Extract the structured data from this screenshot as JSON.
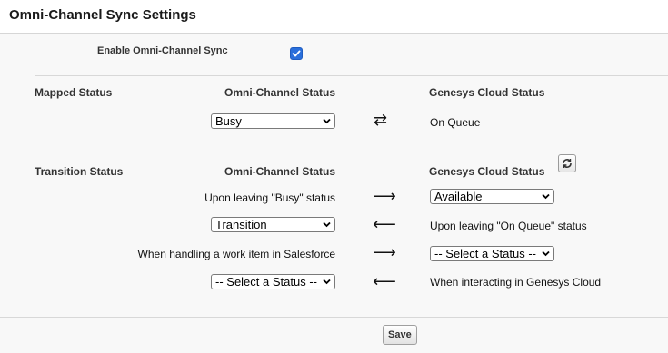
{
  "header": {
    "title": "Omni-Channel Sync Settings"
  },
  "enable_sync": {
    "label": "Enable Omni-Channel Sync",
    "checked": true
  },
  "mapped": {
    "section_label": "Mapped Status",
    "omni_heading": "Omni-Channel Status",
    "genesys_heading": "Genesys Cloud Status",
    "omni_select_value": "Busy",
    "genesys_status": "On Queue",
    "arrow": "⇄"
  },
  "transition": {
    "section_label": "Transition Status",
    "omni_heading": "Omni-Channel Status",
    "genesys_heading": "Genesys Cloud Status",
    "rows": [
      {
        "left": "Upon leaving \"Busy\" status",
        "arrow": "⟶",
        "right": "Available"
      },
      {
        "left": "Transition",
        "arrow": "⟵",
        "right": "Upon leaving \"On Queue\" status"
      },
      {
        "left": "When handling a work item in Salesforce",
        "arrow": "⟶",
        "right": "-- Select a Status --"
      },
      {
        "left": "-- Select a Status --",
        "arrow": "⟵",
        "right": "When interacting in Genesys Cloud"
      }
    ]
  },
  "actions": {
    "save_label": "Save"
  },
  "icons": {
    "refresh": "refresh-icon",
    "checkbox": "checkmark-icon",
    "select": "chevron-down-icon"
  },
  "colors": {
    "checkbox_accent": "#2a6fdb",
    "background": "#f8f8f8"
  }
}
